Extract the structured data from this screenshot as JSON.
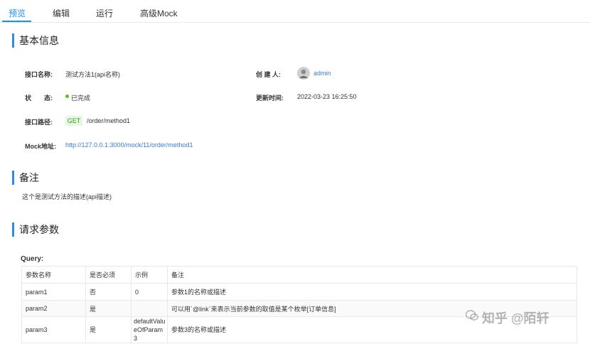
{
  "tabs": [
    "预览",
    "编辑",
    "运行",
    "高级Mock"
  ],
  "sections": {
    "basic": "基本信息",
    "remark": "备注",
    "request": "请求参数"
  },
  "basic": {
    "name_label": "接口名称:",
    "name_value": "测试方法1(api名称)",
    "creator_label": "创 建 人:",
    "creator_value": "admin",
    "status_label": "状　　态:",
    "status_value": "已完成",
    "updated_label": "更新时间:",
    "updated_value": "2022-03-23 16:25:50",
    "path_label": "接口路径:",
    "method": "GET",
    "path_value": "/order/method1",
    "mock_label": "Mock地址:",
    "mock_value": "http://127.0.0.1:3000/mock/11/order/method1"
  },
  "remark_text": "这个是测试方法的描述(api描述)",
  "query_label": "Query:",
  "table": {
    "headers": [
      "参数名称",
      "是否必须",
      "示例",
      "备注"
    ],
    "rows": [
      [
        "param1",
        "否",
        "0",
        "参数1的名称或描述"
      ],
      [
        "param2",
        "是",
        "",
        "可以用`@link`来表示当前参数的取值是某个枚举[订单信息]"
      ],
      [
        "param3",
        "是",
        "defaultValueOfParam3",
        "参数3的名称或描述"
      ]
    ]
  },
  "colors": {
    "accent": "#1890ff",
    "section_bar": "#2d8cf0",
    "success": "#52c41a",
    "get_bg": "#e6f7e6"
  },
  "watermark": "知乎 @陌轩"
}
